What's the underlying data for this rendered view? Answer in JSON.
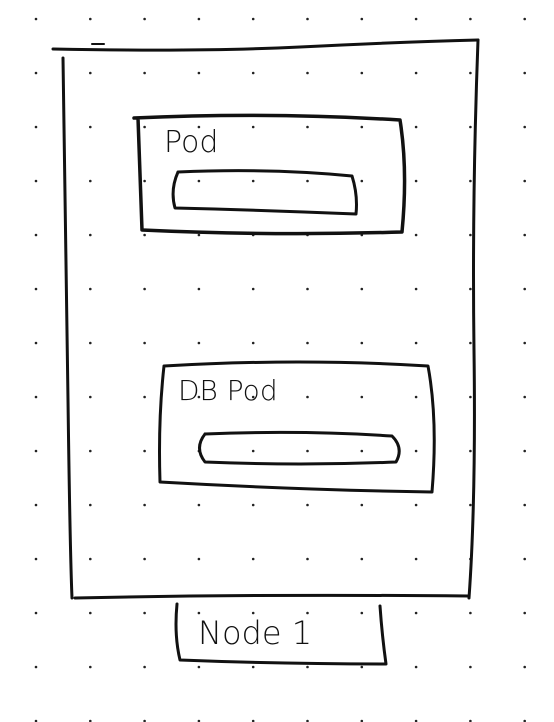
{
  "diagram": {
    "node": {
      "label": "Node 1"
    },
    "pods": [
      {
        "label": "Pod"
      },
      {
        "label": "DB Pod"
      }
    ]
  }
}
